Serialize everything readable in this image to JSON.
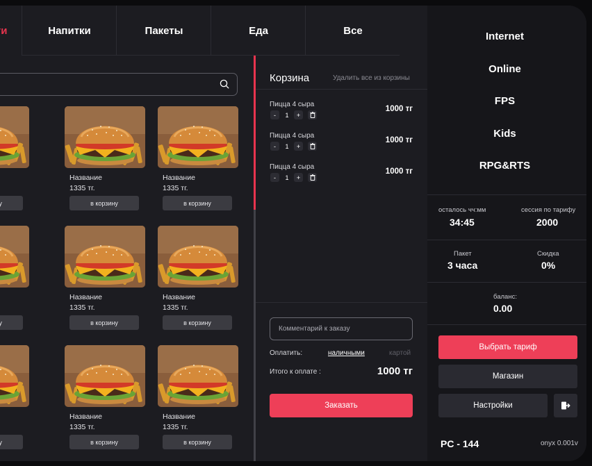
{
  "tabs": [
    {
      "label": "Услуги",
      "active": true
    },
    {
      "label": "Напитки",
      "active": false
    },
    {
      "label": "Пакеты",
      "active": false
    },
    {
      "label": "Еда",
      "active": false
    },
    {
      "label": "Все",
      "active": false
    }
  ],
  "search": {
    "placeholder": ""
  },
  "product": {
    "name": "Название",
    "price": "1335 тг.",
    "button": "в корзину"
  },
  "cart": {
    "title": "Корзина",
    "clear_label": "Удалить все из корзины",
    "items": [
      {
        "name": "Пицца 4 сыра",
        "qty": "1",
        "price": "1000 тг"
      },
      {
        "name": "Пицца 4 сыра",
        "qty": "1",
        "price": "1000 тг"
      },
      {
        "name": "Пицца 4 сыра",
        "qty": "1",
        "price": "1000 тг"
      }
    ],
    "minus": "-",
    "plus": "+",
    "comment_placeholder": "Комментарий к заказу",
    "pay_label": "Оплатить:",
    "pay_cash": "наличными",
    "pay_card": "картой",
    "total_label": "Итого к оплате :",
    "total_value": "1000 тг",
    "order_button": "Заказать"
  },
  "right": {
    "categories": [
      "Internet",
      "Online",
      "FPS",
      "Kids",
      "RPG&RTS"
    ],
    "time_left_label": "осталось чч:мм",
    "time_left_value": "34:45",
    "session_label": "сессия по тарифу",
    "session_value": "2000",
    "package_label": "Пакет",
    "package_value": "3 часа",
    "discount_label": "Скидка",
    "discount_value": "0%",
    "balance_label": "баланс:",
    "balance_value": "0.00",
    "choose_tariff": "Выбрать тариф",
    "shop": "Магазин",
    "settings": "Настройки",
    "pc_label": "PC - 144",
    "version": "onyx 0.001v"
  },
  "colors": {
    "accent": "#ee3f58",
    "background": "#1c1c21",
    "panel": "#16161a"
  }
}
